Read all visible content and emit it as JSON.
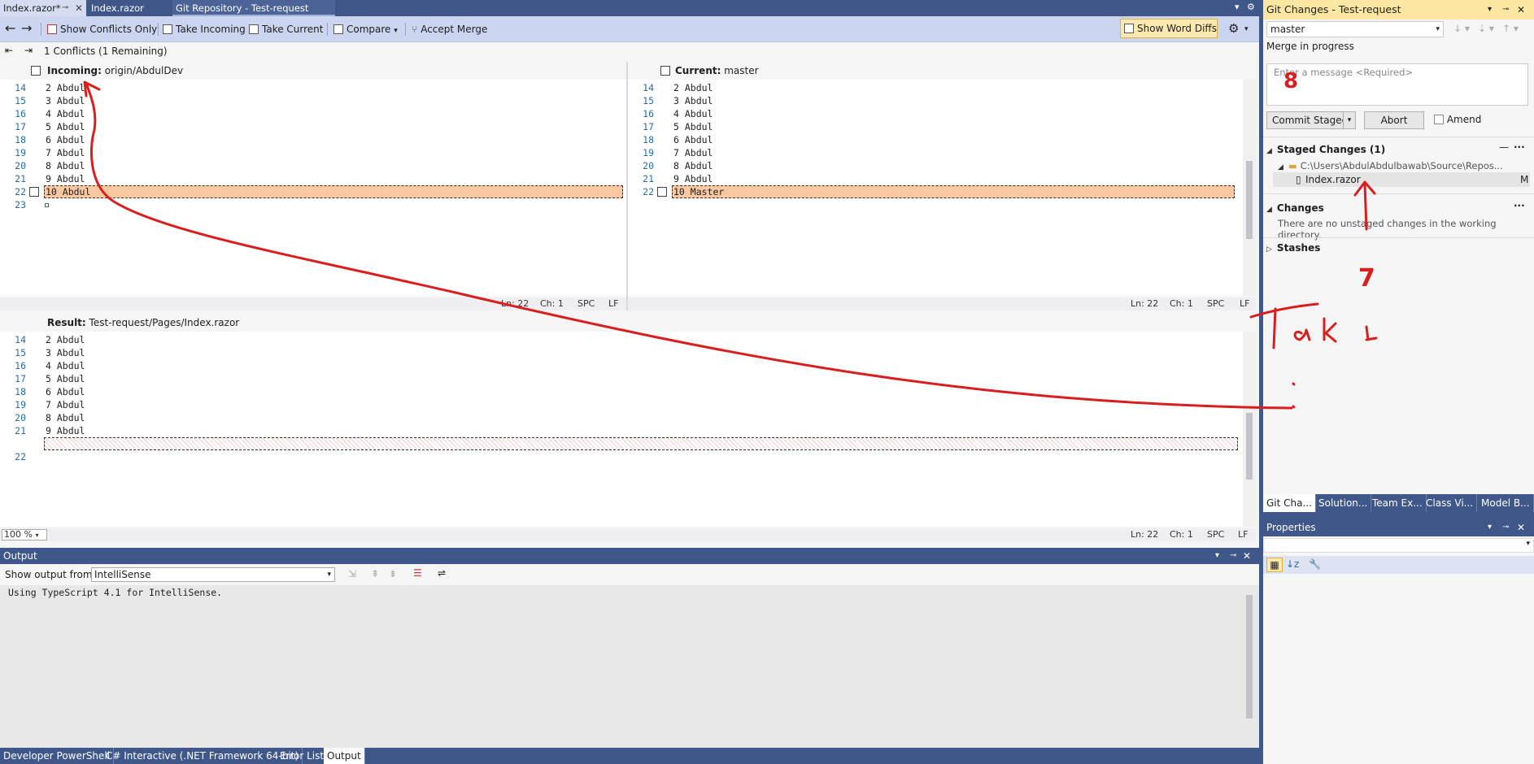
{
  "tabs": [
    {
      "label": "Index.razor*"
    },
    {
      "label": "Index.razor"
    },
    {
      "label": "Git Repository - Test-request"
    }
  ],
  "toolbar": {
    "show_conflicts_only": "Show Conflicts Only",
    "take_incoming": "Take Incoming",
    "take_current": "Take Current",
    "compare": "Compare",
    "accept_merge": "Accept Merge",
    "show_word_diffs": "Show Word Diffs"
  },
  "conflicts": {
    "summary": "1 Conflicts (1 Remaining)"
  },
  "incoming": {
    "label": "Incoming:",
    "branch": "origin/AbdulDev",
    "line_numbers": [
      "14",
      "15",
      "16",
      "17",
      "18",
      "19",
      "20",
      "21",
      "22",
      "23"
    ],
    "lines": [
      "2 Abdul",
      "3 Abdul",
      "4 Abdul",
      "5 Abdul",
      "6 Abdul",
      "7 Abdul",
      "8 Abdul",
      "9 Abdul",
      "10 Abdul",
      ""
    ],
    "status": {
      "ln": "Ln: 22",
      "ch": "Ch: 1",
      "spc": "SPC",
      "lf": "LF"
    }
  },
  "current": {
    "label": "Current:",
    "branch": "master",
    "line_numbers": [
      "14",
      "15",
      "16",
      "17",
      "18",
      "19",
      "20",
      "21",
      "22"
    ],
    "lines": [
      "2 Abdul",
      "3 Abdul",
      "4 Abdul",
      "5 Abdul",
      "6 Abdul",
      "7 Abdul",
      "8 Abdul",
      "9 Abdul",
      "10 Master"
    ],
    "status": {
      "ln": "Ln: 22",
      "ch": "Ch: 1",
      "spc": "SPC",
      "lf": "LF"
    }
  },
  "result": {
    "label": "Result:",
    "path": "Test-request/Pages/Index.razor",
    "line_numbers": [
      "14",
      "15",
      "16",
      "17",
      "18",
      "19",
      "20",
      "21",
      "",
      "22"
    ],
    "lines": [
      "2 Abdul",
      "3 Abdul",
      "4 Abdul",
      "5 Abdul",
      "6 Abdul",
      "7 Abdul",
      "8 Abdul",
      "9 Abdul",
      "",
      ""
    ],
    "zoom": "100 %",
    "status": {
      "ln": "Ln: 22",
      "ch": "Ch: 1",
      "spc": "SPC",
      "lf": "LF"
    }
  },
  "output": {
    "title": "Output",
    "show_from_label": "Show output from:",
    "source": "IntelliSense",
    "text": "Using TypeScript 4.1 for IntelliSense."
  },
  "bottom_tabs": [
    "Developer PowerShell",
    "C# Interactive (.NET Framework 64-bit)",
    "Error List",
    "Output"
  ],
  "git_changes": {
    "title": "Git Changes - Test-request",
    "branch": "master",
    "merge_status": "Merge in progress",
    "message_placeholder": "Enter a message <Required>",
    "commit_button": "Commit Staged",
    "abort_button": "Abort",
    "amend_label": "Amend",
    "staged_header": "Staged Changes (1)",
    "staged_path": "C:\\Users\\AbdulAbdulbawab\\Source\\Repos...",
    "staged_file": "Index.razor",
    "staged_file_status": "M",
    "changes_header": "Changes",
    "changes_empty": "There are no unstaged changes in the working directory.",
    "stashes_header": "Stashes"
  },
  "right_tabs": [
    "Git Cha...",
    "Solution...",
    "Team Ex...",
    "Class Vi...",
    "Model B..."
  ],
  "properties": {
    "title": "Properties"
  },
  "colors": {
    "title_bar": "#3f5789",
    "toolbar": "#ccd5f0",
    "conflict": "#f9c8a0",
    "annotation": "#d81e1e",
    "git_header": "#fce7a2"
  },
  "annotations": {
    "number_8": "8",
    "number_7": "7",
    "scribble": "Take"
  }
}
